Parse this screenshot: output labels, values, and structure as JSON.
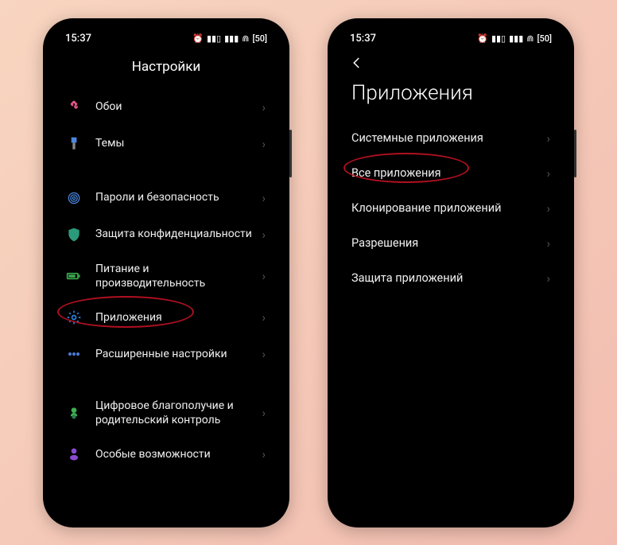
{
  "status": {
    "time": "15:37"
  },
  "icon_glyphs": {
    "alarm": "⏰",
    "signal": "▮▮▯",
    "signal2": "▮▮▮",
    "wifi": "⋒",
    "battery": "[50]"
  },
  "left": {
    "title": "Настройки",
    "sections": [
      {
        "items": [
          {
            "key": "wallpaper",
            "label": "Обои",
            "icon": "flower",
            "color": "#e05585"
          },
          {
            "key": "themes",
            "label": "Темы",
            "icon": "brush",
            "color": "#4a88e0"
          }
        ]
      },
      {
        "items": [
          {
            "key": "security",
            "label": "Пароли и безопасность",
            "icon": "fingerprint",
            "color": "#4a88e0"
          },
          {
            "key": "privacy",
            "label": "Защита конфиденциальности",
            "icon": "shield",
            "color": "#2a9a7a"
          },
          {
            "key": "battery",
            "label": "Питание и производительность",
            "icon": "battery",
            "color": "#3cb050"
          },
          {
            "key": "apps",
            "label": "Приложения",
            "icon": "gear",
            "color": "#2a85e0",
            "highlighted": true
          },
          {
            "key": "advanced",
            "label": "Расширенные настройки",
            "icon": "dots",
            "color": "#4a78d0"
          }
        ]
      },
      {
        "items": [
          {
            "key": "wellbeing",
            "label": "Цифровое благополучие и родительский контроль",
            "icon": "heart",
            "color": "#3cb050"
          },
          {
            "key": "accessibility",
            "label": "Особые возможности",
            "icon": "person",
            "color": "#8a4ad0"
          }
        ]
      }
    ]
  },
  "right": {
    "title": "Приложения",
    "items": [
      {
        "key": "system-apps",
        "label": "Системные приложения"
      },
      {
        "key": "all-apps",
        "label": "Все приложения",
        "highlighted": true
      },
      {
        "key": "clone-apps",
        "label": "Клонирование приложений"
      },
      {
        "key": "permissions",
        "label": "Разрешения"
      },
      {
        "key": "app-lock",
        "label": "Защита приложений"
      }
    ]
  }
}
